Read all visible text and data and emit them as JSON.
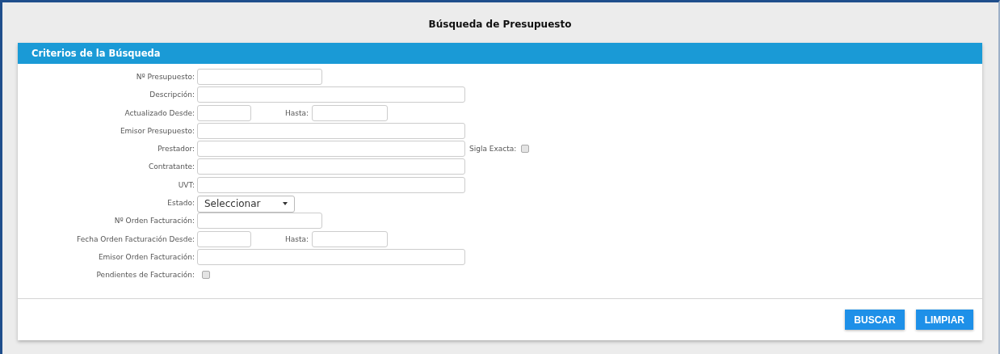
{
  "window": {
    "title": "Búsqueda de Presupuesto"
  },
  "panel": {
    "title": "Criterios de la Búsqueda"
  },
  "rows": [
    {
      "kind": "short_text",
      "label": "Nº Presupuesto:"
    },
    {
      "kind": "long_text",
      "label": "Descripción:"
    },
    {
      "kind": "range",
      "label": "Actualizado Desde:",
      "second_label": "Hasta:"
    },
    {
      "kind": "long_text",
      "label": "Emisor Presupuesto:"
    },
    {
      "kind": "long_text",
      "label": "Prestador:",
      "extra": {
        "label": "Sigla Exacta:",
        "checked": false
      }
    },
    {
      "kind": "long_text",
      "label": "Contratante:"
    },
    {
      "kind": "long_text",
      "label": "UVT:"
    },
    {
      "kind": "select",
      "label": "Estado:",
      "value": "Seleccionar"
    },
    {
      "kind": "short_text",
      "label": "Nº Orden Facturación:"
    },
    {
      "kind": "range",
      "label": "Fecha Orden Facturación Desde:",
      "second_label": "Hasta:"
    },
    {
      "kind": "long_text",
      "label": "Emisor Orden Facturación:"
    },
    {
      "kind": "checkbox",
      "label": "Pendientes de Facturación:",
      "checked": false
    }
  ],
  "buttons": [
    "BUSCAR",
    "LIMPIAR"
  ]
}
